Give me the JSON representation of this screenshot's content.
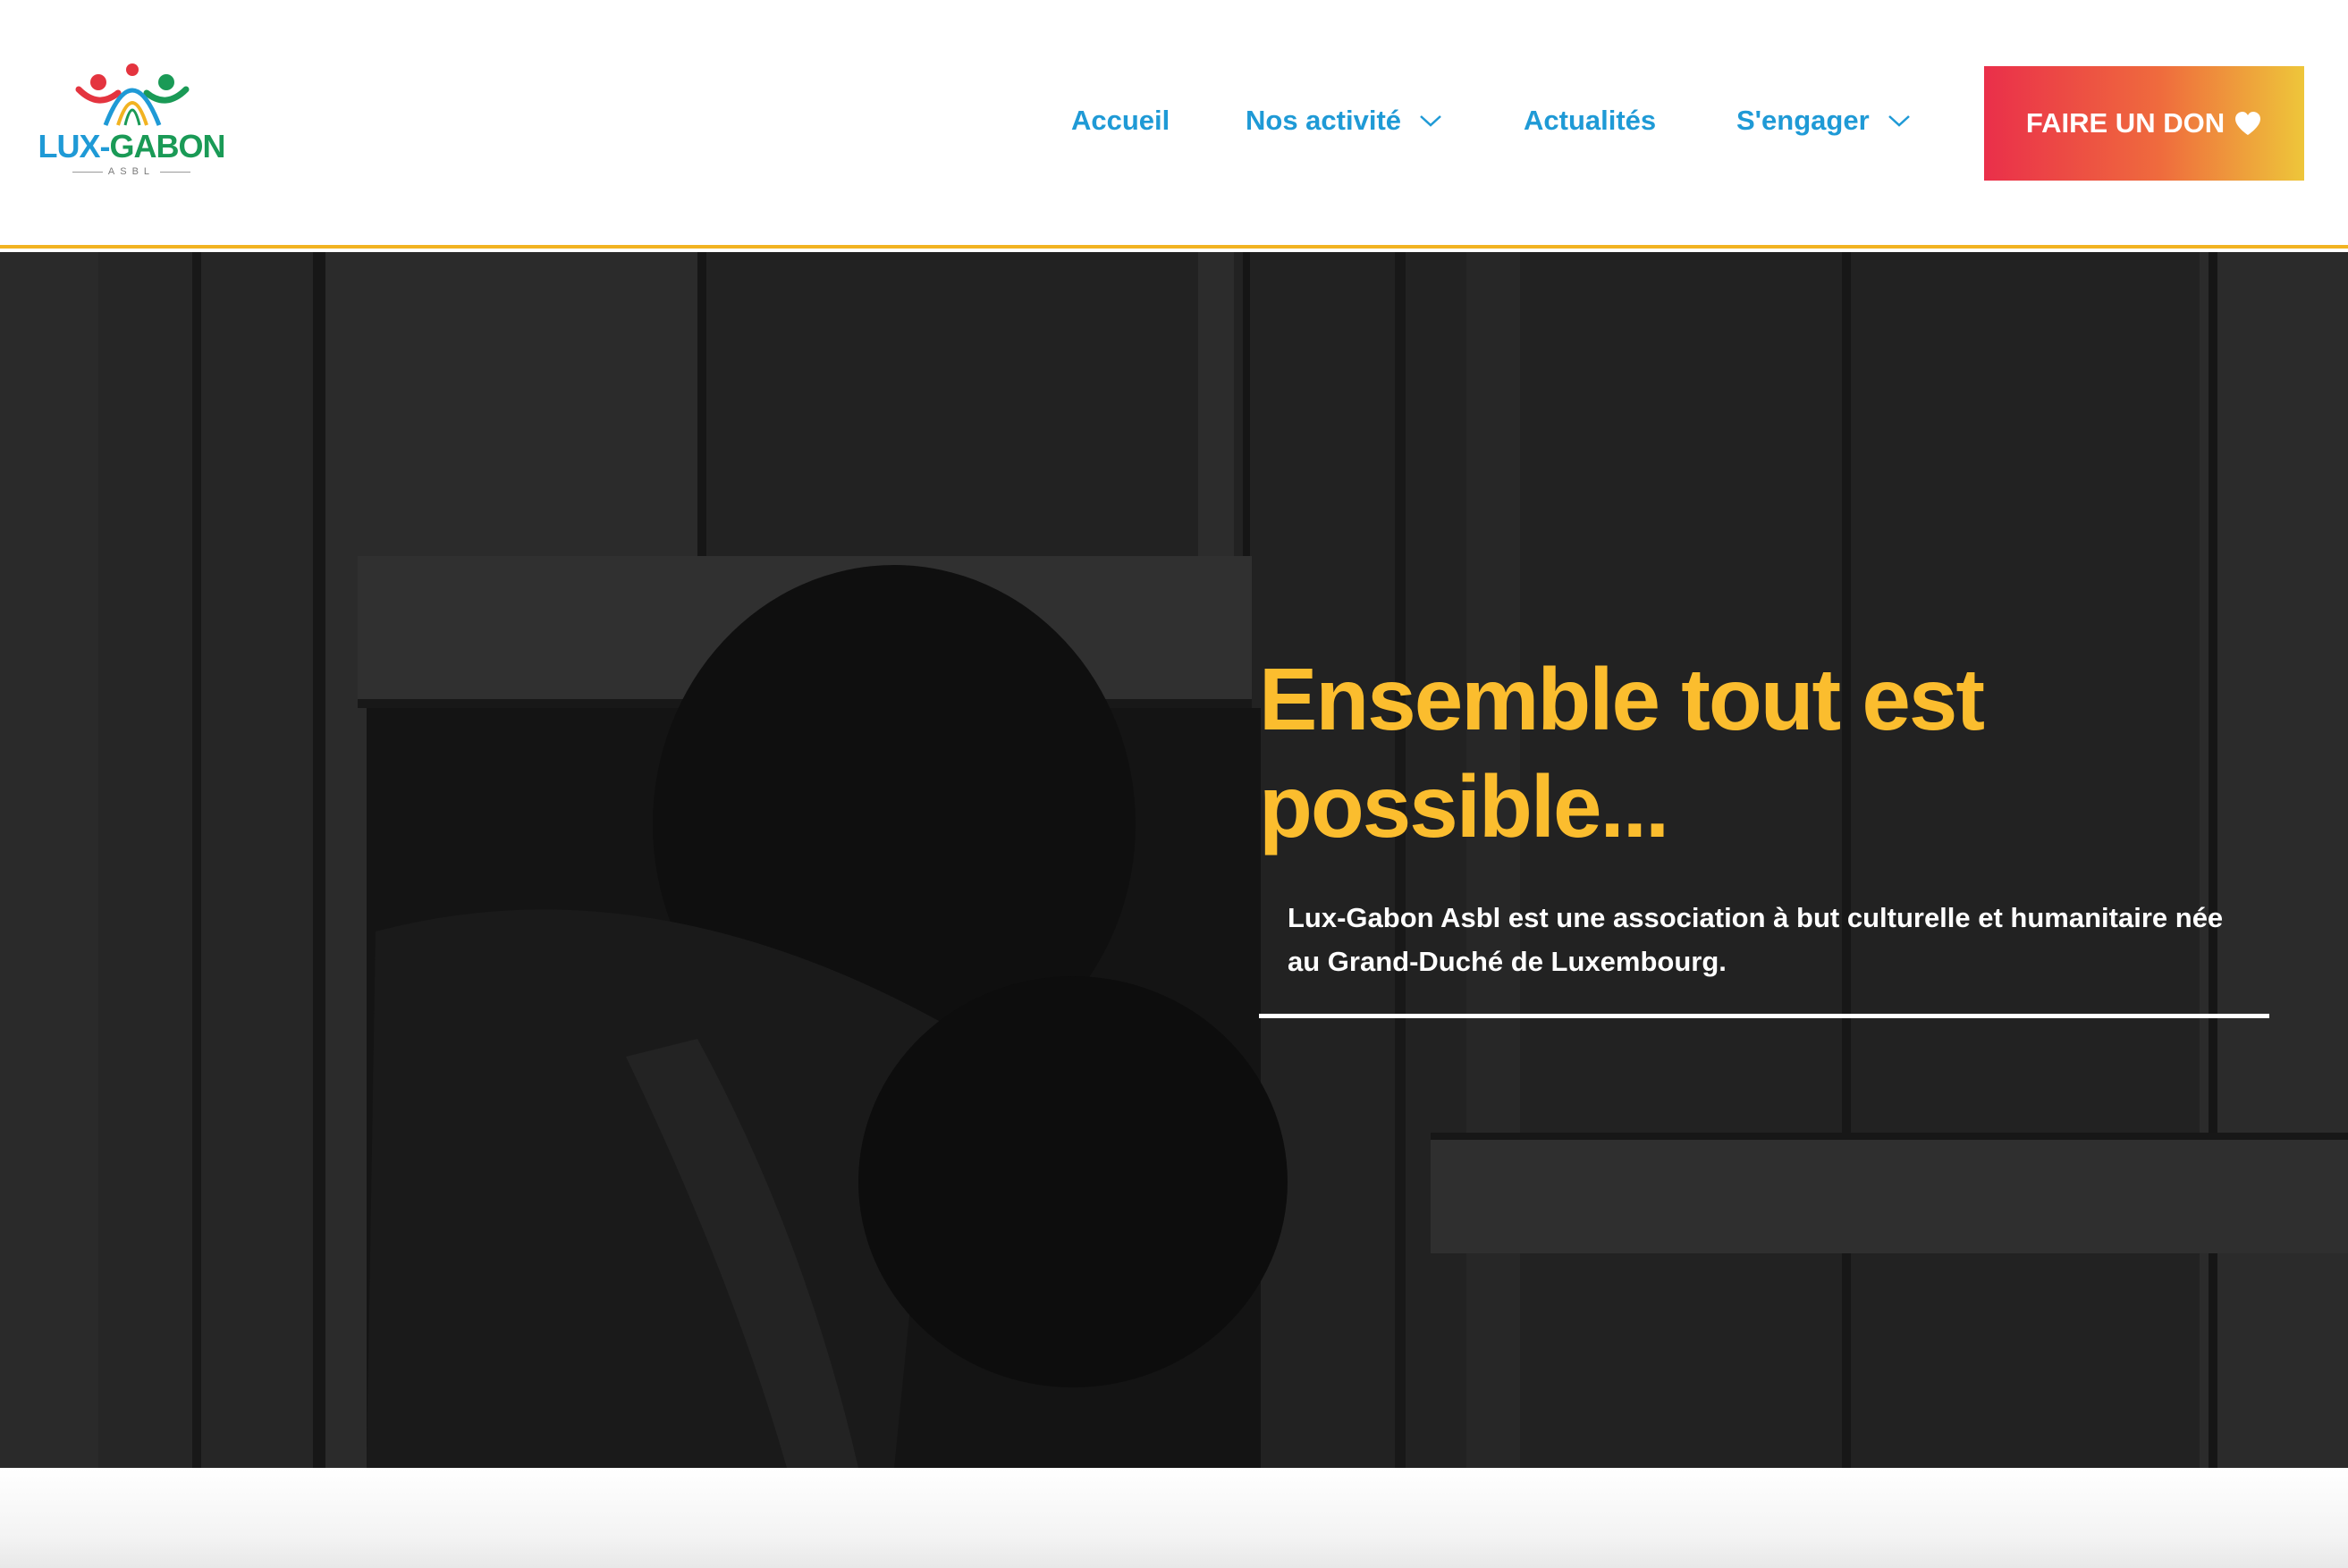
{
  "brand": {
    "name_part1": "LUX-",
    "name_part2": "GABON",
    "subtitle": "ASBL"
  },
  "nav": {
    "items": [
      {
        "label": "Accueil",
        "has_dropdown": false
      },
      {
        "label": "Nos activité",
        "has_dropdown": true
      },
      {
        "label": "Actualités",
        "has_dropdown": false
      },
      {
        "label": "S'engager",
        "has_dropdown": true
      }
    ],
    "donate_label": "FAIRE UN DON",
    "donate_icon": "heart-icon"
  },
  "hero": {
    "title": "Ensemble tout est possible...",
    "text": "Lux-Gabon Asbl est une association à but culturelle et humanitaire née au Grand-Duché de Luxembourg."
  },
  "colors": {
    "nav_link": "#1f9ad6",
    "brand_green": "#1a9a56",
    "header_border": "#f2b321",
    "hero_title": "#fbbd2e",
    "donate_gradient_start": "#ea2f4a",
    "donate_gradient_end": "#eec63a",
    "hero_background": "#1e1e1e"
  }
}
